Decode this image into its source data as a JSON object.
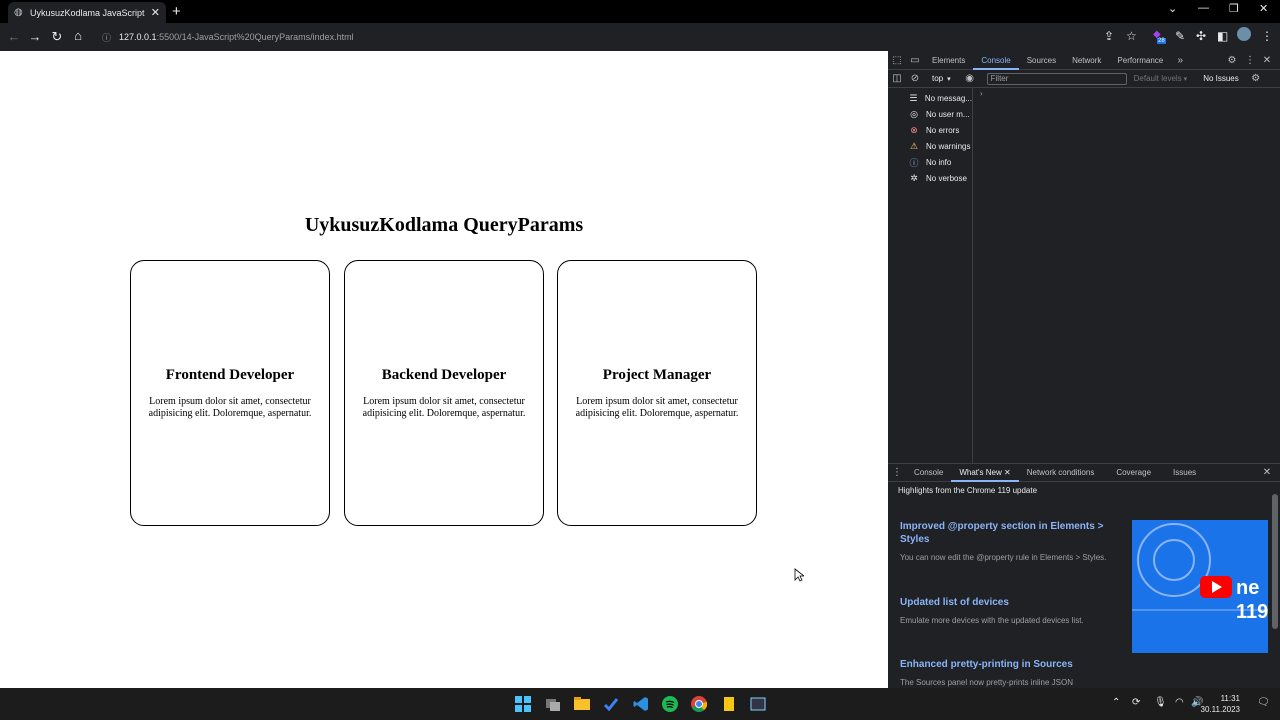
{
  "browser": {
    "tab_title": "UykusuzKodlama JavaScript Qu",
    "url_host": "127.0.0.1",
    "url_path": ":5500/14-JavaScript%20QueryParams/index.html",
    "extension_badge": "28"
  },
  "page": {
    "heading": "UykusuzKodlama QueryParams",
    "cards": [
      {
        "title": "Frontend Developer",
        "text": "Lorem ipsum dolor sit amet, consectetur adipisicing elit. Doloremque, aspernatur."
      },
      {
        "title": "Backend Developer",
        "text": "Lorem ipsum dolor sit amet, consectetur adipisicing elit. Doloremque, aspernatur."
      },
      {
        "title": "Project Manager",
        "text": "Lorem ipsum dolor sit amet, consectetur adipisicing elit. Doloremque, aspernatur."
      }
    ]
  },
  "devtools": {
    "tabs": [
      "Elements",
      "Console",
      "Sources",
      "Network",
      "Performance"
    ],
    "active_tab": "Console",
    "context": "top",
    "filter_placeholder": "Filter",
    "levels": "Default levels",
    "issues": "No Issues",
    "sidebar": [
      {
        "icon": "list-icon",
        "label": "No messag..."
      },
      {
        "icon": "user-icon",
        "label": "No user m..."
      },
      {
        "icon": "error-icon",
        "label": "No errors"
      },
      {
        "icon": "warning-icon",
        "label": "No warnings"
      },
      {
        "icon": "info-icon",
        "label": "No info"
      },
      {
        "icon": "bug-icon",
        "label": "No verbose"
      }
    ],
    "drawer_tabs": [
      "Console",
      "What's New",
      "Network conditions",
      "Coverage",
      "Issues"
    ],
    "drawer_active": "What's New",
    "highlights": "Highlights from the Chrome 119 update",
    "whats_new": [
      {
        "title": "Improved @property section in Elements > Styles",
        "desc": "You can now edit the @property rule in Elements > Styles."
      },
      {
        "title": "Updated list of devices",
        "desc": "Emulate more devices with the updated devices list."
      },
      {
        "title": "Enhanced pretty-printing in Sources",
        "desc": "The Sources panel now pretty-prints inline JSON"
      }
    ],
    "thumb_text": "ne 119"
  },
  "taskbar": {
    "time": "11:31",
    "date": "30.11.2023"
  },
  "colors": {
    "accent": "#8ab4f8",
    "devtools_bg": "#202124",
    "taskbar_bg": "#1c1c1c"
  }
}
